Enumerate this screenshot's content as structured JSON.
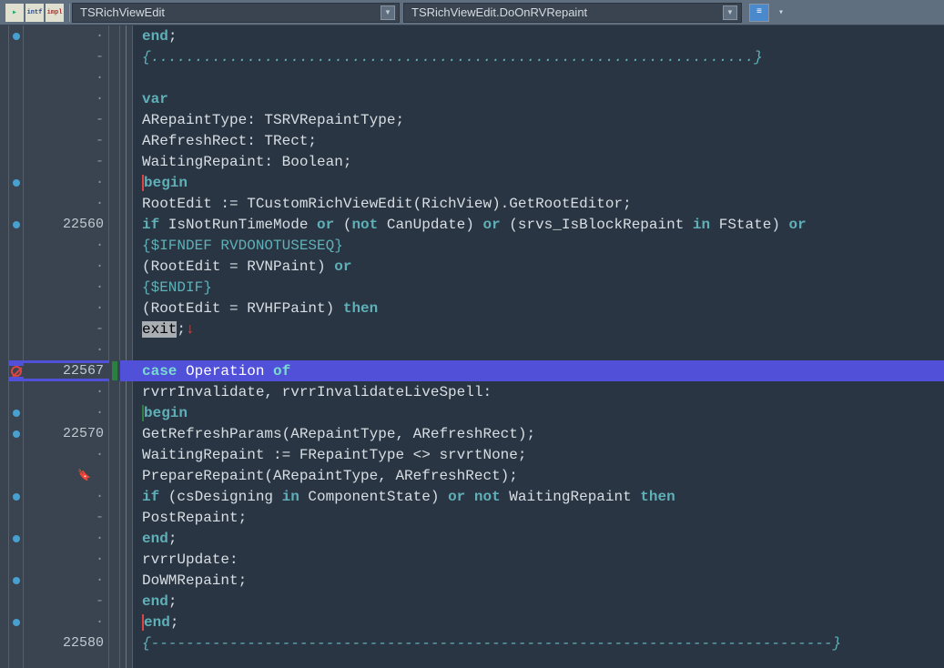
{
  "toolbar": {
    "combo1": "TSRichViewEdit",
    "combo2": "TSRichViewEdit.DoOnRVRepaint"
  },
  "visible_line_numbers": {
    "l22560": "22560",
    "l22567": "22567",
    "l22570": "22570",
    "l22580": "22580"
  },
  "code": {
    "l1": {
      "indent": "    ",
      "t1": "end",
      "t2": ";"
    },
    "l2": {
      "indent": "  ",
      "t": "{.....................................................................}"
    },
    "l3": {
      "indent": ""
    },
    "l4": {
      "indent": "",
      "t": "var"
    },
    "l5": {
      "indent": "  ",
      "t": "ARepaintType:   TSRVRepaintType;"
    },
    "l6": {
      "indent": "  ",
      "t": "ARefreshRect:   TRect;"
    },
    "l7": {
      "indent": "  ",
      "t": "WaitingRepaint: Boolean;"
    },
    "l8": {
      "indent": "",
      "t": "begin"
    },
    "l9": {
      "indent": "  ",
      "t": "RootEdit := TCustomRichViewEdit(RichView).GetRootEditor;"
    },
    "l10": {
      "indent": "  ",
      "k1": "if",
      "t1": " IsNotRunTimeMode ",
      "k2": "or",
      "t2": " (",
      "k3": "not",
      "t3": " CanUpdate) ",
      "k4": "or",
      "t4": " (srvs_IsBlockRepaint ",
      "k5": "in",
      "t5": " FState) ",
      "k6": "or"
    },
    "l11": {
      "indent": "  ",
      "t": "{$IFNDEF RVDONOTUSESEQ}"
    },
    "l12": {
      "indent": "    ",
      "t": "(RootEdit = RVNPaint) ",
      "k": "or"
    },
    "l13": {
      "indent": "  ",
      "t": "{$ENDIF}"
    },
    "l14": {
      "indent": "    ",
      "t": "(RootEdit = RVHFPaint) ",
      "k": "then"
    },
    "l15": {
      "indent": "    ",
      "sel": "exit",
      "t": ";"
    },
    "l16": {
      "indent": ""
    },
    "l17": {
      "indent": "  ",
      "k1": "case",
      "t1": " Operation ",
      "k2": "of"
    },
    "l18": {
      "indent": "    ",
      "t": "rvrrInvalidate, rvrrInvalidateLiveSpell:"
    },
    "l19": {
      "indent": "      ",
      "t": "begin"
    },
    "l20": {
      "indent": "        ",
      "t": "GetRefreshParams(ARepaintType, ARefreshRect);"
    },
    "l21": {
      "indent": "        ",
      "t": "WaitingRepaint := FRepaintType <> srvrtNone;"
    },
    "l22": {
      "indent": "        ",
      "t": "PrepareRepaint(ARepaintType, ARefreshRect);"
    },
    "l23": {
      "indent": "        ",
      "k1": "if",
      "t1": " (csDesigning ",
      "k2": "in",
      "t2": " ComponentState) ",
      "k3": "or not",
      "t3": " WaitingRepaint ",
      "k4": "then"
    },
    "l24": {
      "indent": "          ",
      "t": "PostRepaint;"
    },
    "l25": {
      "indent": "      ",
      "k": "end",
      "t": ";"
    },
    "l26": {
      "indent": "    ",
      "t": "rvrrUpdate:"
    },
    "l27": {
      "indent": "      ",
      "t": "DoWMRepaint;"
    },
    "l28": {
      "indent": "  ",
      "k": "end",
      "t": ";"
    },
    "l29": {
      "indent": "",
      "k": "end",
      "t": ";"
    },
    "l30": {
      "indent": "",
      "t": "{------------------------------------------------------------------------------}"
    }
  },
  "gutter": {
    "dot": "·",
    "dash": "-"
  }
}
